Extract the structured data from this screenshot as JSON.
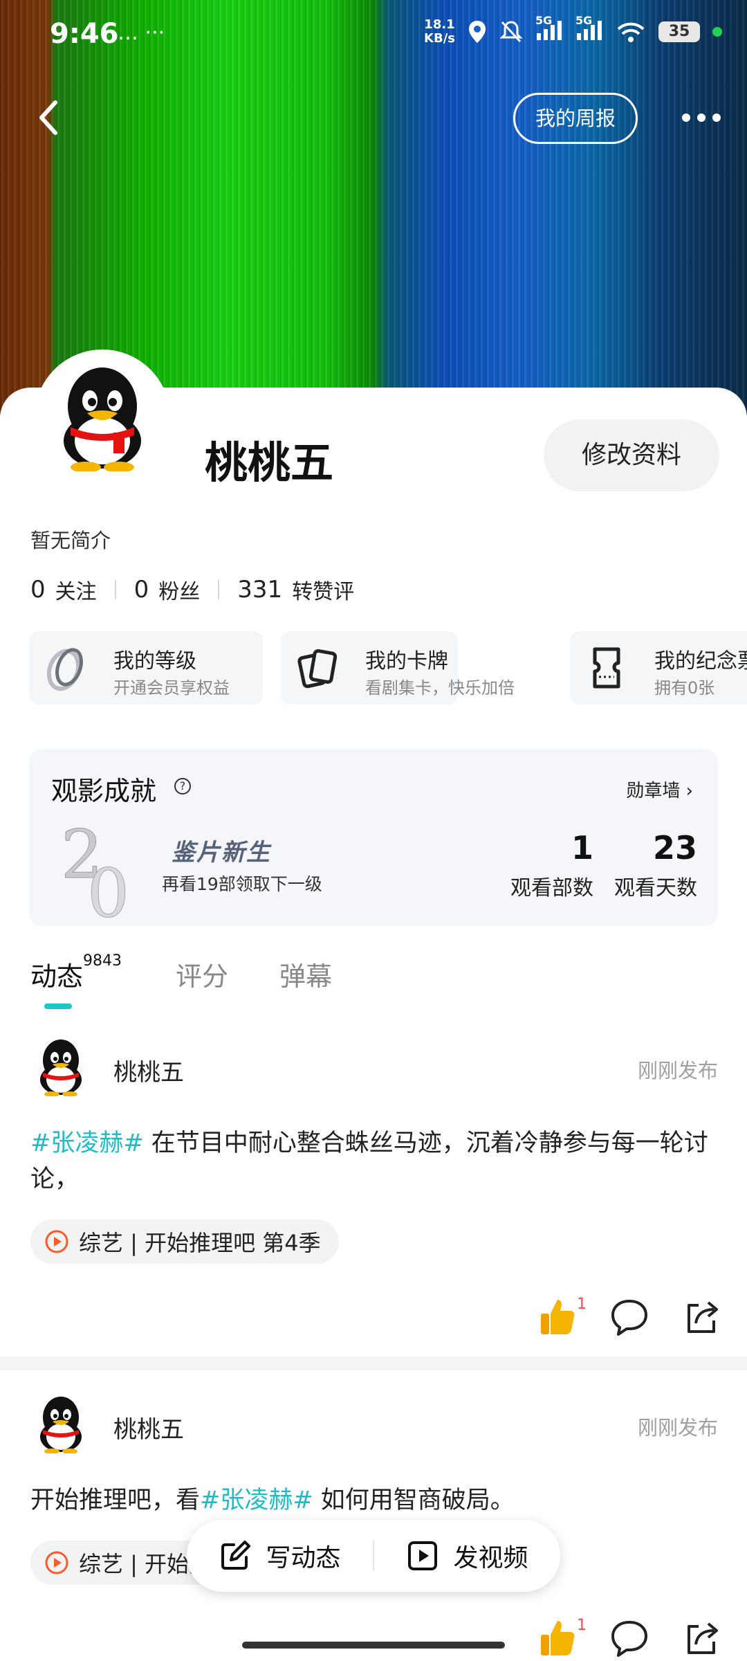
{
  "status_bar": {
    "time": "9:46",
    "left_icons": "… ···",
    "net_speed_value": "18.1",
    "net_speed_unit": "KB/s",
    "signal_1": "5G",
    "signal_2": "5G",
    "battery": "35"
  },
  "header": {
    "weekly_report_label": "我的周报"
  },
  "profile": {
    "username": "桃桃五",
    "edit_label": "修改资料",
    "bio": "暂无简介",
    "stats": [
      {
        "value": "0",
        "label": "关注"
      },
      {
        "value": "0",
        "label": "粉丝"
      },
      {
        "value": "331",
        "label": "转赞评"
      }
    ]
  },
  "quick_links": [
    {
      "title": "我的等级",
      "subtitle": "开通会员享权益",
      "icon": "ring-icon"
    },
    {
      "title": "我的卡牌",
      "subtitle": "看剧集卡，快乐加倍",
      "icon": "cards-icon"
    },
    {
      "title": "我的纪念票",
      "subtitle": "拥有0张",
      "icon": "ticket-icon"
    }
  ],
  "achievement": {
    "title": "观影成就",
    "medal_wall": "勋章墙",
    "level_name": "鉴片新生",
    "level_hint": "再看19部领取下一级",
    "watched_count": "1",
    "watched_count_label": "观看部数",
    "watch_days": "23",
    "watch_days_label": "观看天数"
  },
  "tabs": [
    {
      "label": "动态",
      "count": "9843",
      "active": true
    },
    {
      "label": "评分",
      "active": false
    },
    {
      "label": "弹幕",
      "active": false
    }
  ],
  "posts": [
    {
      "author": "桃桃五",
      "time": "刚刚发布",
      "tag": "#张凌赫#",
      "text_before": "",
      "text_after": " 在节目中耐心整合蛛丝马迹，沉着冷静参与每一轮讨论，",
      "chip": "综艺 | 开始推理吧 第4季",
      "likes": "1"
    },
    {
      "author": "桃桃五",
      "time": "刚刚发布",
      "tag": "#张凌赫#",
      "text_before": "开始推理吧，看",
      "text_after": " 如何用智商破局。",
      "chip": "综艺 | 开始推理吧 第4季",
      "likes": "1"
    }
  ],
  "fab": {
    "write_post": "写动态",
    "post_video": "发视频"
  }
}
